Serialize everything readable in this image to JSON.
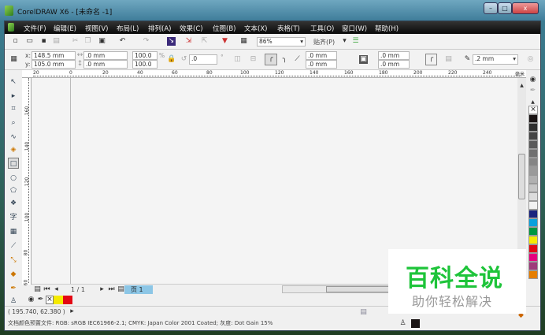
{
  "window": {
    "title": "CorelDRAW X6 - [未命名 -1]",
    "min": "–",
    "max": "□",
    "close": "x"
  },
  "menu": [
    "文件(F)",
    "编辑(E)",
    "视图(V)",
    "布局(L)",
    "排列(A)",
    "效果(C)",
    "位图(B)",
    "文本(X)",
    "表格(T)",
    "工具(O)",
    "窗口(W)",
    "帮助(H)"
  ],
  "toolbar": {
    "zoom": "86%",
    "snap": "贴齐(P)"
  },
  "propbar": {
    "x_label": "x:",
    "y_label": "y:",
    "x": "148.5 mm",
    "y": "105.0 mm",
    "w": ".0 mm",
    "h": ".0 mm",
    "scale_x": "100.0",
    "scale_y": "100.0",
    "pct": "%",
    "angle": ".0",
    "deg": "°",
    "corner1": ".0 mm",
    "corner2": ".0 mm",
    "corner3": ".0 mm",
    "corner4": ".0 mm",
    "outline": ".2 mm"
  },
  "ruler": {
    "top": [
      "20",
      "0",
      "20",
      "40",
      "60",
      "80",
      "100",
      "120",
      "140",
      "160",
      "180",
      "200",
      "220",
      "240"
    ],
    "unit": "毫米",
    "left": [
      "160",
      "140",
      "120",
      "100",
      "80",
      "60"
    ]
  },
  "pagebar": {
    "count": "1 / 1",
    "tab": "页 1"
  },
  "status": {
    "coords": "( 195.740, 62.380 )",
    "profile": "文档颜色预置文件: RGB: sRGB IEC61966-2.1; CMYK: Japan Color 2001 Coated; 灰度: Dot Gain 15%"
  },
  "palette": [
    "#1a1414",
    "#2e2e2e",
    "#444444",
    "#5a5a5a",
    "#707070",
    "#858585",
    "#9a9a9a",
    "#b0b0b0",
    "#c6c6c6",
    "#dcdcdc",
    "#f2f2f2",
    "#1a237e",
    "#0aa0dc",
    "#009640",
    "#f5ea00",
    "#e30613",
    "#e5007e",
    "#9e3a7a",
    "#e67e00"
  ],
  "doc_colors": [
    "#f5ea00",
    "#e30613"
  ],
  "watermark": {
    "line1": "百科全说",
    "line2": "助你轻松解决"
  }
}
